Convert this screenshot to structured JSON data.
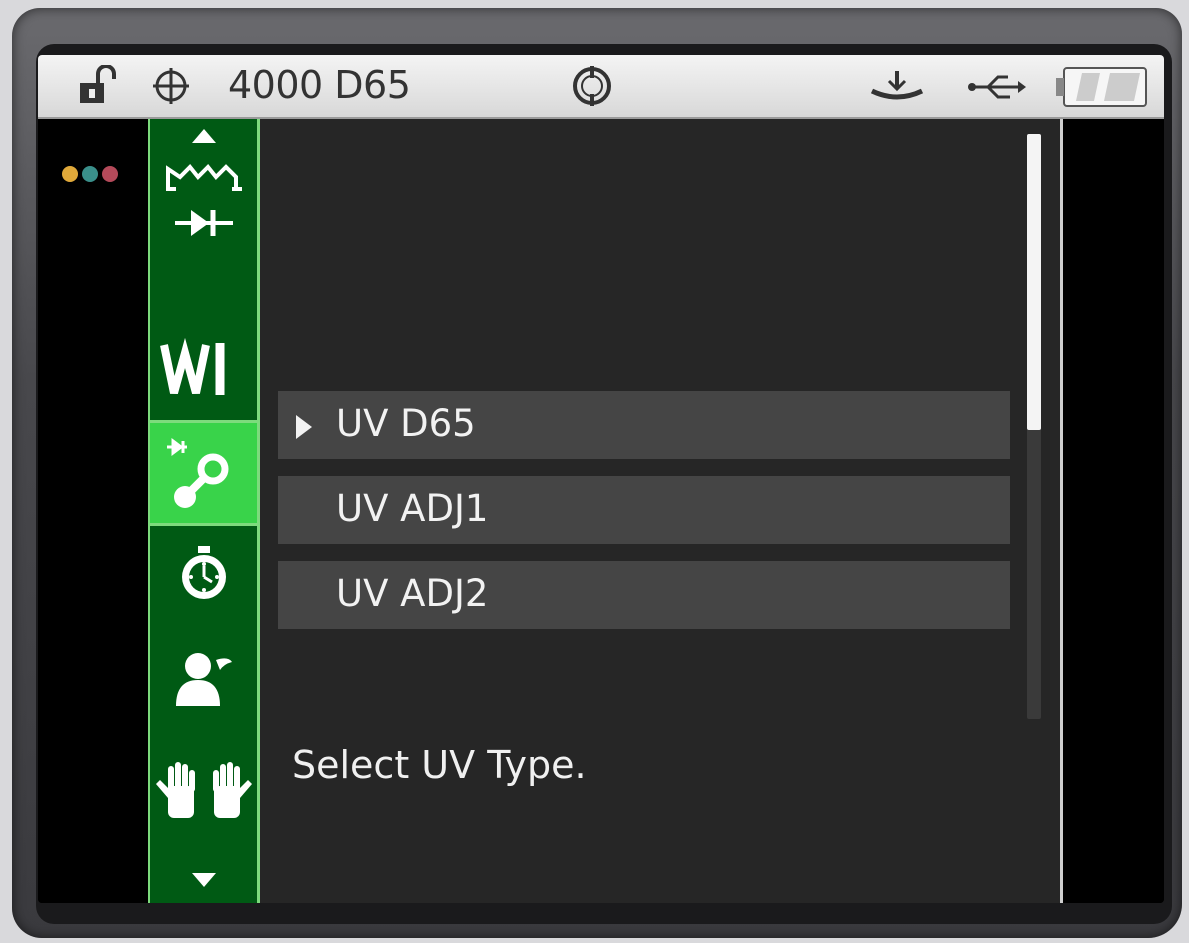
{
  "status_bar": {
    "text": "4000 D65",
    "icons": [
      "lock-open-icon",
      "crosshair-icon",
      "target-icon",
      "ground-icon",
      "usb-icon",
      "battery-icon"
    ]
  },
  "indicator_dots": {
    "colors": [
      "#e0a93a",
      "#3a8f8a",
      "#b44a5a"
    ]
  },
  "rail": {
    "icons": [
      "up-arrow-icon",
      "waveform-icon",
      "diode-icon",
      "wi-icon",
      "uv-probe-icon",
      "timer-icon",
      "user-icon",
      "hands-icon",
      "down-arrow-icon"
    ],
    "selected": "uv-probe-icon",
    "wi_label": "WI",
    "accent_color": "#39d34a",
    "background_color": "#005a14"
  },
  "menu": {
    "items": [
      {
        "label": "UV D65",
        "selected": true
      },
      {
        "label": "UV ADJ1",
        "selected": false
      },
      {
        "label": "UV ADJ2",
        "selected": false
      }
    ],
    "scroll_fraction": 0.5
  },
  "hint": "Select UV Type."
}
